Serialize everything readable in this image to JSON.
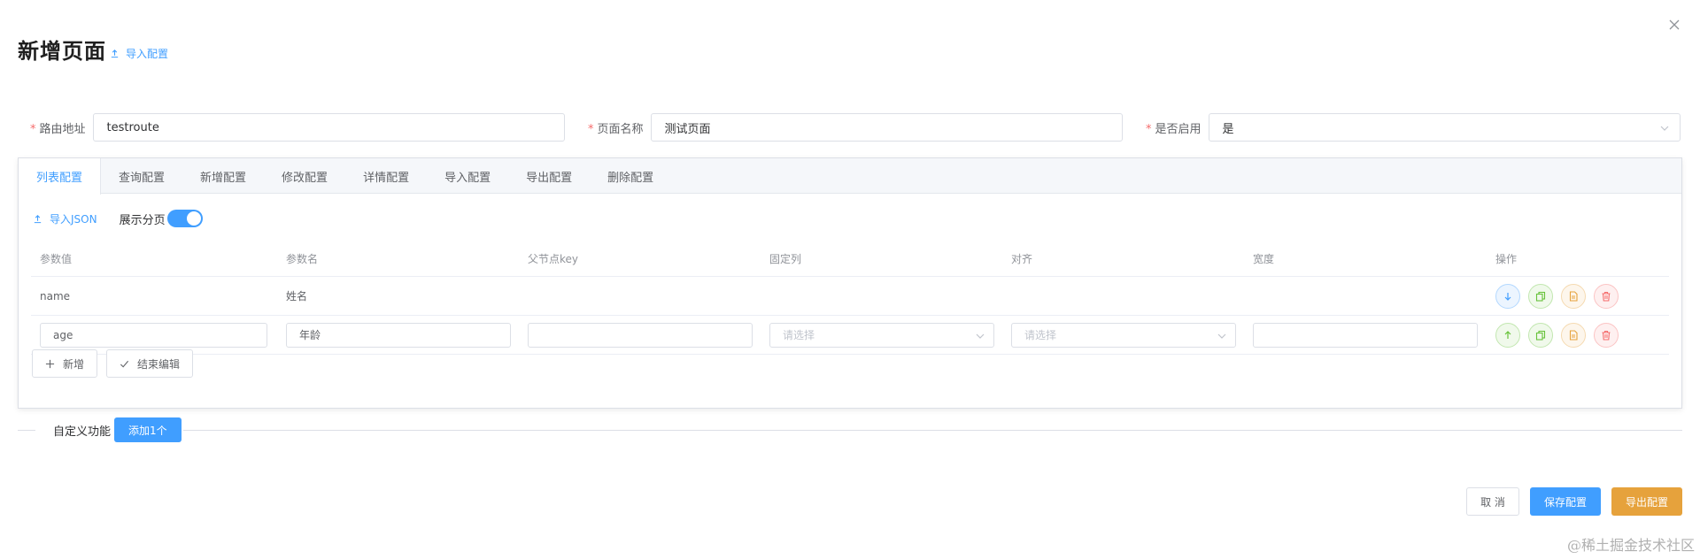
{
  "dialog": {
    "title": "新增页面",
    "import_config_label": "导入配置"
  },
  "form": {
    "route": {
      "label": "路由地址",
      "value": "testroute"
    },
    "page_name": {
      "label": "页面名称",
      "value": "测试页面"
    },
    "enabled": {
      "label": "是否启用",
      "value": "是"
    }
  },
  "tabs": [
    {
      "label": "列表配置",
      "active": true
    },
    {
      "label": "查询配置",
      "active": false
    },
    {
      "label": "新增配置",
      "active": false
    },
    {
      "label": "修改配置",
      "active": false
    },
    {
      "label": "详情配置",
      "active": false
    },
    {
      "label": "导入配置",
      "active": false
    },
    {
      "label": "导出配置",
      "active": false
    },
    {
      "label": "删除配置",
      "active": false
    }
  ],
  "toolbar": {
    "import_json_label": "导入JSON",
    "show_pagination_label": "展示分页",
    "show_pagination_on": true
  },
  "table": {
    "headers": [
      "参数值",
      "参数名",
      "父节点key",
      "固定列",
      "对齐",
      "宽度",
      "操作"
    ],
    "rows": [
      {
        "param_value": "name",
        "param_name": "姓名",
        "parent_key": "",
        "fixed": "",
        "align": "",
        "width": ""
      },
      {
        "param_value": "age",
        "param_name": "年龄",
        "parent_key": "",
        "fixed_placeholder": "请选择",
        "align_placeholder": "请选择",
        "width": ""
      }
    ]
  },
  "row_actions": {
    "add_label": "新增",
    "finish_edit_label": "结束编辑"
  },
  "custom": {
    "label": "自定义功能",
    "add_one_label": "添加1个"
  },
  "footer": {
    "cancel_label": "取 消",
    "save_label": "保存配置",
    "export_label": "导出配置"
  },
  "watermark": "@稀土掘金技术社区",
  "colors": {
    "primary": "#409eff",
    "warning": "#e6a23c",
    "success": "#67c23a",
    "danger": "#f56c6c"
  }
}
